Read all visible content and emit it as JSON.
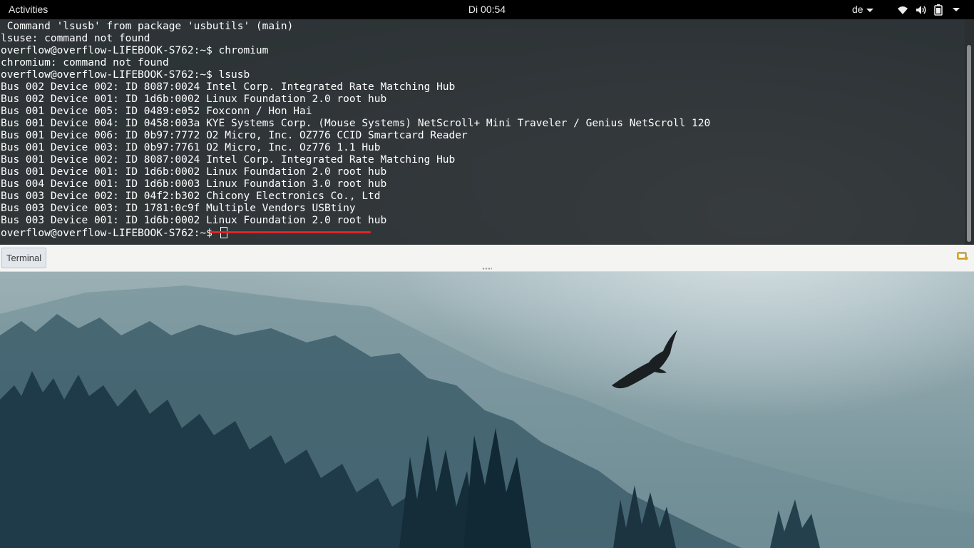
{
  "topbar": {
    "activities_label": "Activities",
    "clock": "Di 00:54",
    "keyboard_layout": "de"
  },
  "terminal": {
    "lines": [
      " Command 'lsusb' from package 'usbutils' (main)",
      "lsuse: command not found",
      "overflow@overflow-LIFEBOOK-S762:~$ chromium",
      "chromium: command not found",
      "overflow@overflow-LIFEBOOK-S762:~$ lsusb",
      "Bus 002 Device 002: ID 8087:0024 Intel Corp. Integrated Rate Matching Hub",
      "Bus 002 Device 001: ID 1d6b:0002 Linux Foundation 2.0 root hub",
      "Bus 001 Device 005: ID 0489:e052 Foxconn / Hon Hai",
      "Bus 001 Device 004: ID 0458:003a KYE Systems Corp. (Mouse Systems) NetScroll+ Mini Traveler / Genius NetScroll 120",
      "Bus 001 Device 006: ID 0b97:7772 O2 Micro, Inc. OZ776 CCID Smartcard Reader",
      "Bus 001 Device 003: ID 0b97:7761 O2 Micro, Inc. Oz776 1.1 Hub",
      "Bus 001 Device 002: ID 8087:0024 Intel Corp. Integrated Rate Matching Hub",
      "Bus 001 Device 001: ID 1d6b:0002 Linux Foundation 2.0 root hub",
      "Bus 004 Device 001: ID 1d6b:0003 Linux Foundation 3.0 root hub",
      "Bus 003 Device 002: ID 04f2:b302 Chicony Electronics Co., Ltd",
      "Bus 003 Device 003: ID 1781:0c9f Multiple Vendors USBtiny",
      "Bus 003 Device 001: ID 1d6b:0002 Linux Foundation 2.0 root hub"
    ],
    "prompt": "overflow@overflow-LIFEBOOK-S762:~$ "
  },
  "panel": {
    "task_label": "Terminal"
  },
  "colors": {
    "underline": "#e02424",
    "terminal_bg": "#24282a",
    "topbar_bg": "#000000"
  },
  "icons": [
    "wifi-icon",
    "volume-icon",
    "battery-icon",
    "tray-menu-caret-icon",
    "notification-tray-icon"
  ]
}
